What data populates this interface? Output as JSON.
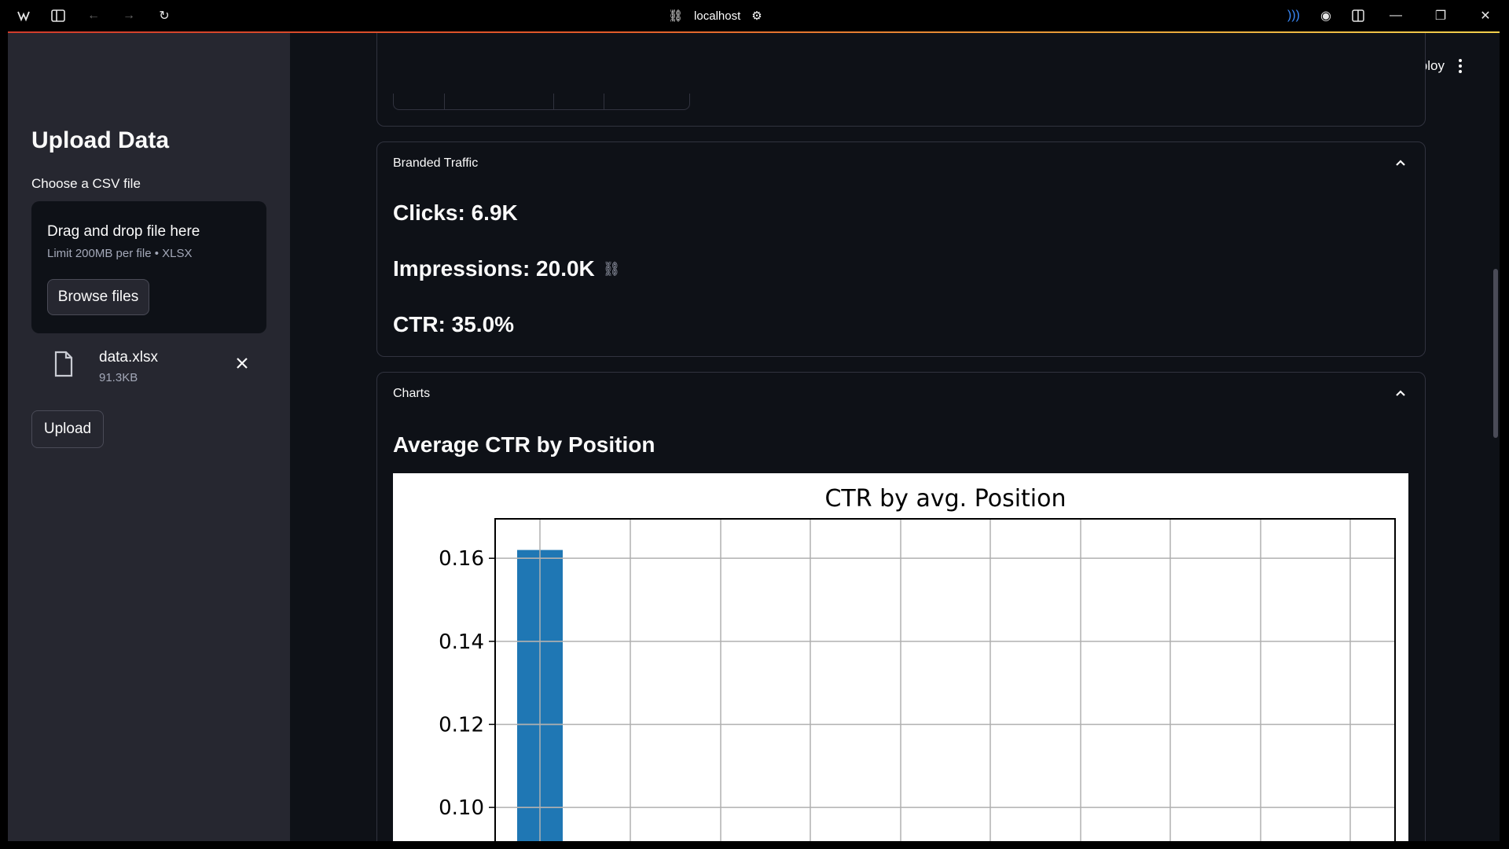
{
  "browser": {
    "url": "localhost"
  },
  "sidebar": {
    "title": "Upload Data",
    "uploader_label": "Choose a CSV file",
    "dropzone_title": "Drag and drop file here",
    "dropzone_limit": "Limit 200MB per file • XLSX",
    "browse_label": "Browse files",
    "file": {
      "name": "data.xlsx",
      "size": "91.3KB"
    },
    "upload_label": "Upload"
  },
  "header": {
    "deploy_label": "Deploy"
  },
  "branded": {
    "label": "Branded Traffic",
    "clicks": "Clicks: 6.9K",
    "impressions": "Impressions: 20.0K",
    "ctr": "CTR: 35.0%"
  },
  "charts": {
    "label": "Charts",
    "section_title": "Average CTR by Position"
  },
  "chart_data": {
    "type": "bar",
    "title": "CTR by avg. Position",
    "xlabel": "",
    "ylabel": "",
    "y_ticks": [
      "0.10",
      "0.12",
      "0.14",
      "0.16"
    ],
    "visible_ylim": [
      0.0915,
      0.1695
    ],
    "grid": true,
    "series": [
      {
        "values": [
          0.162
        ]
      }
    ],
    "bar_color": "#1f77b4"
  }
}
